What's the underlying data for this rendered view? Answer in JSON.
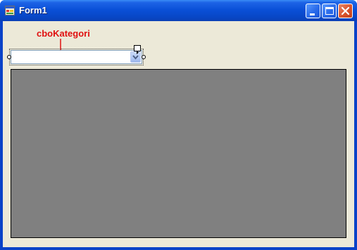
{
  "window": {
    "title": "Form1",
    "buttons": {
      "minimize": "minimize-icon",
      "maximize": "maximize-icon",
      "close": "close-icon"
    }
  },
  "annotation": {
    "label": "cboKategori",
    "color": "#e01010"
  },
  "combo": {
    "name": "cboKategori",
    "value": ""
  },
  "colors": {
    "titlebar": "#0a50d8",
    "client": "#ece9d8",
    "panel": "#808080"
  }
}
